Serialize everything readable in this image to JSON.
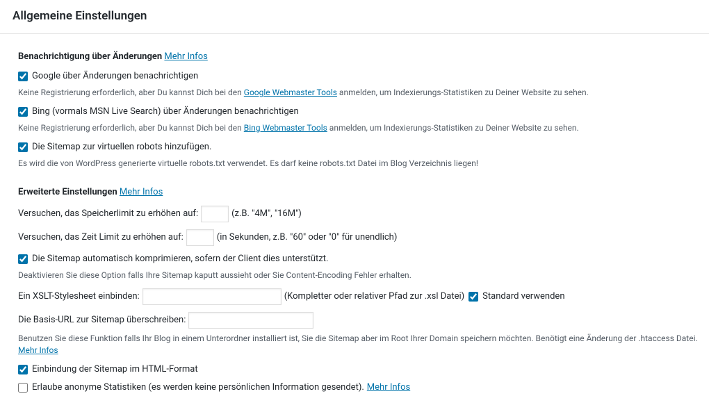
{
  "page_title": "Allgemeine Einstellungen",
  "notify": {
    "header": "Benachrichtigung über Änderungen",
    "more_label": "Mehr Infos",
    "google_label": "Google über Änderungen benachrichtigen",
    "google_desc_pre": "Keine Registrierung erforderlich, aber Du kannst Dich bei den ",
    "google_link": "Google Webmaster Tools",
    "google_desc_post": " anmelden, um Indexierungs-Statistiken zu Deiner Website zu sehen.",
    "bing_label": "Bing (vormals MSN Live Search) über Änderungen benachrichtigen",
    "bing_desc_pre": "Keine Registrierung erforderlich, aber Du kannst Dich bei den ",
    "bing_link": "Bing Webmaster Tools",
    "bing_desc_post": " anmelden, um Indexierungs-Statistiken zu Deiner Website zu sehen.",
    "robots_label": "Die Sitemap zur virtuellen robots hinzufügen.",
    "robots_desc": "Es wird die von WordPress generierte virtuelle robots.txt verwendet. Es darf keine robots.txt Datei im Blog Verzeichnis liegen!"
  },
  "advanced": {
    "header": "Erweiterte Einstellungen",
    "more_label": "Mehr Infos",
    "mem_label": "Versuchen, das Speicherlimit zu erhöhen auf:",
    "mem_hint": "(z.B. \"4M\", \"16M\")",
    "time_label": "Versuchen, das Zeit Limit zu erhöhen auf:",
    "time_hint": "(in Sekunden, z.B. \"60\" oder \"0\" für unendlich)",
    "gzip_label": "Die Sitemap automatisch komprimieren, sofern der Client dies unterstützt.",
    "gzip_desc": "Deaktivieren Sie diese Option falls Ihre Sitemap kaputt aussieht oder Sie Content-Encoding Fehler erhalten.",
    "xslt_label": "Ein XSLT-Stylesheet einbinden:",
    "xslt_hint": "(Kompletter oder relativer Pfad zur .xsl Datei)",
    "xslt_default": "Standard verwenden",
    "baseurl_label": "Die Basis-URL zur Sitemap überschreiben:",
    "baseurl_desc_pre": "Benutzen Sie diese Funktion falls Ihr Blog in einem Unterordner installiert ist, Sie die Sitemap aber im Root Ihrer Domain speichern möchten. Benötigt eine Änderung der .htaccess Datei. ",
    "baseurl_more": "Mehr Infos",
    "html_label": "Einbindung der Sitemap im HTML-Format",
    "stats_label": "Erlaube anonyme Statistiken (es werden keine persönlichen Information gesendet). ",
    "stats_more": "Mehr Infos"
  }
}
